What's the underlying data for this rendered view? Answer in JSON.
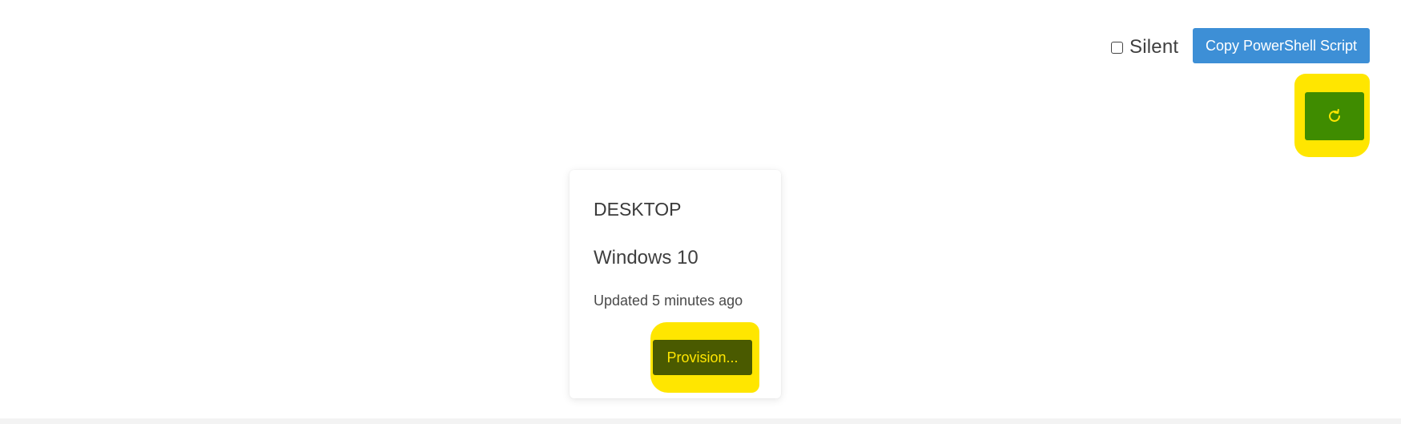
{
  "toolbar": {
    "silent_label": "Silent",
    "silent_checked": false,
    "copy_script_label": "Copy PowerShell Script",
    "refresh_icon": "refresh-icon"
  },
  "card": {
    "title": "DESKTOP",
    "os": "Windows 10",
    "updated": "Updated 5 minutes ago",
    "provision_label": "Provision..."
  },
  "colors": {
    "copy_button": "#3d8fd6",
    "refresh_button": "#3f8c00",
    "provision_button": "#4a5a00",
    "highlight": "#ffe600"
  }
}
